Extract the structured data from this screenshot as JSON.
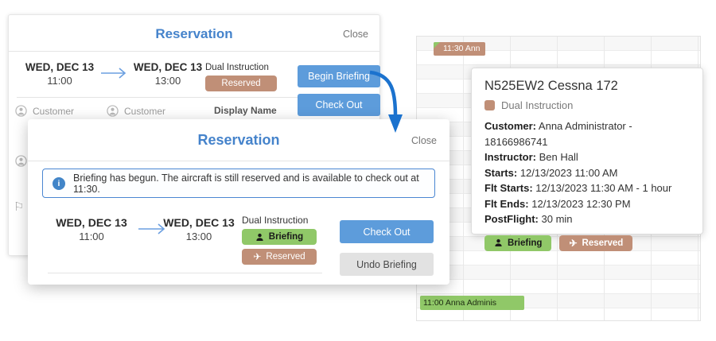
{
  "dialog_back": {
    "title": "Reservation",
    "close_label": "Close",
    "start_date": "WED, DEC 13",
    "start_time": "11:00",
    "end_date": "WED, DEC 13",
    "end_time": "13:00",
    "type_label": "Dual Instruction",
    "reserved_badge": "Reserved",
    "begin_briefing_label": "Begin Briefing",
    "check_out_label": "Check Out",
    "customer1_label": "Customer",
    "customer2_label": "Customer",
    "display_name_label": "Display Name"
  },
  "dialog_front": {
    "title": "Reservation",
    "close_label": "Close",
    "info_message": "Briefing has begun. The aircraft is still reserved and is available to check out at 11:30.",
    "start_date": "WED, DEC 13",
    "start_time": "11:00",
    "end_date": "WED, DEC 13",
    "end_time": "13:00",
    "type_label": "Dual Instruction",
    "briefing_badge": "Briefing",
    "reserved_badge": "Reserved",
    "check_out_label": "Check Out",
    "undo_briefing_label": "Undo Briefing"
  },
  "calendar": {
    "event_chip_top": "11:30 Ann",
    "event_chip_bottom": "11:00 Anna Adminis"
  },
  "tooltip": {
    "title": "N525EW2 Cessna 172",
    "type_label": "Dual Instruction",
    "fields": [
      {
        "label": "Customer:",
        "value": "Anna Administrator - 18166986741"
      },
      {
        "label": "Instructor:",
        "value": "Ben Hall"
      },
      {
        "label": "Starts:",
        "value": "12/13/2023 11:00 AM"
      },
      {
        "label": "Flt Starts:",
        "value": "12/13/2023 11:30 AM - 1 hour"
      },
      {
        "label": "Flt Ends:",
        "value": "12/13/2023 12:30 PM"
      },
      {
        "label": "PostFlight:",
        "value": "30 min"
      }
    ],
    "briefing_badge": "Briefing",
    "reserved_badge": "Reserved"
  },
  "icons": {
    "airplane": "✈",
    "flag": "⚐",
    "info": "i"
  },
  "colors": {
    "accent_blue": "#4583cb",
    "button_blue": "#5d9cdb",
    "tan": "#c08f77",
    "green": "#90c868",
    "arrow_blue": "#1b72ce"
  }
}
